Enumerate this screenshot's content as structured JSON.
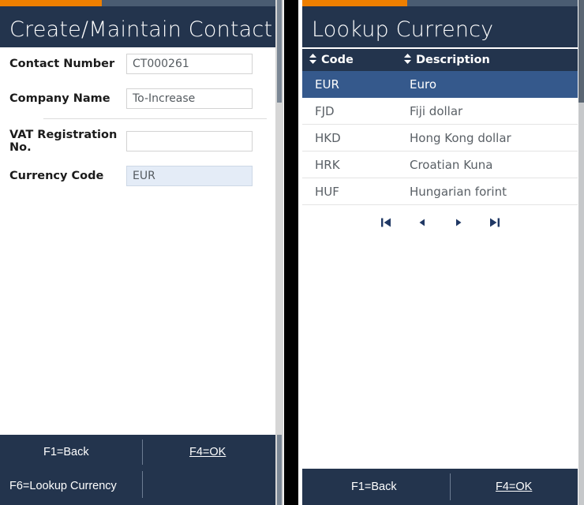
{
  "left": {
    "progress": {
      "percent": 37,
      "fill_color": "#ee7f00",
      "track_color": "#4a5c72"
    },
    "title": "Create/Maintain Contact",
    "form": {
      "fields": [
        {
          "label": "Contact Number",
          "value": "CT000261",
          "placeholder": "",
          "highlighted": false
        },
        {
          "label": "Company Name",
          "value": "To-Increase",
          "placeholder": "",
          "highlighted": false
        },
        {
          "label": "VAT Registration No.",
          "value": "",
          "placeholder": "",
          "highlighted": false
        },
        {
          "label": "Currency Code",
          "value": "EUR",
          "placeholder": "",
          "highlighted": true
        }
      ]
    },
    "footer": {
      "back_label": "F1=Back",
      "ok_label": "F4=OK",
      "lookup_label": "F6=Lookup Currency"
    }
  },
  "right": {
    "progress": {
      "percent": 38,
      "fill_color": "#ee7f00",
      "track_color": "#4a5c72"
    },
    "title": "Lookup Currency",
    "table": {
      "columns": [
        {
          "label": "Code",
          "sort_icon": "sort-updown-icon"
        },
        {
          "label": "Description",
          "sort_icon": "sort-updown-icon"
        }
      ],
      "rows": [
        {
          "code": "EUR",
          "description": "Euro",
          "selected": true
        },
        {
          "code": "FJD",
          "description": "Fiji dollar",
          "selected": false
        },
        {
          "code": "HKD",
          "description": "Hong Kong dollar",
          "selected": false
        },
        {
          "code": "HRK",
          "description": "Croatian Kuna",
          "selected": false
        },
        {
          "code": "HUF",
          "description": "Hungarian forint",
          "selected": false
        }
      ],
      "selected_row_color": "#35598c",
      "header_color": "#23344d"
    },
    "pagination": {
      "buttons": [
        {
          "name": "first-page-icon",
          "title": "First"
        },
        {
          "name": "previous-page-icon",
          "title": "Previous"
        },
        {
          "name": "next-page-icon",
          "title": "Next"
        },
        {
          "name": "last-page-icon",
          "title": "Last"
        }
      ]
    },
    "footer": {
      "back_label": "F1=Back",
      "ok_label": "F4=OK"
    }
  }
}
